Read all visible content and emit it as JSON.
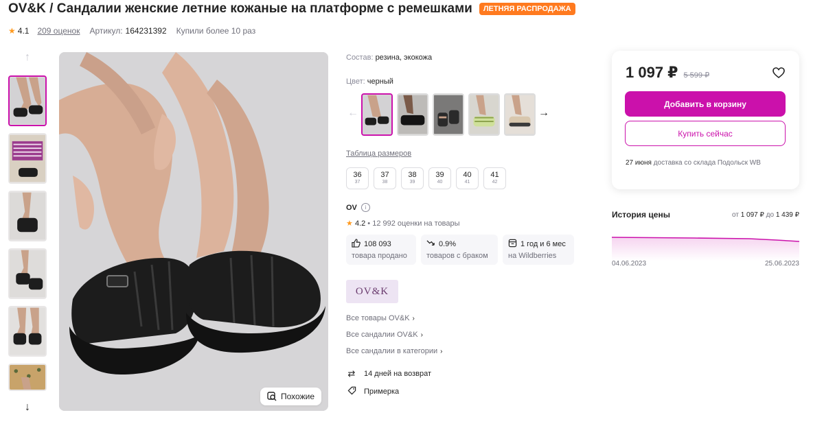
{
  "product": {
    "title": "OV&K / Сандалии женские летние кожаные на платформе с ремешками",
    "badge": "ЛЕТНЯЯ РАСПРОДАЖА",
    "rating": "4.1",
    "reviews": "209 оценок",
    "article_label": "Артикул:",
    "article_value": "164231392",
    "bought": "Купили более 10 раз"
  },
  "gallery": {
    "similar_label": "Похожие"
  },
  "details": {
    "composition_label": "Состав:",
    "composition_value": "резина, экокожа",
    "color_label": "Цвет:",
    "color_value": "черный",
    "size_table_link": "Таблица размеров",
    "sizes": [
      {
        "main": "36",
        "sub": "37"
      },
      {
        "main": "37",
        "sub": "38"
      },
      {
        "main": "38",
        "sub": "39"
      },
      {
        "main": "39",
        "sub": "40"
      },
      {
        "main": "40",
        "sub": "41"
      },
      {
        "main": "41",
        "sub": "42"
      }
    ]
  },
  "seller": {
    "name": "OV",
    "rating": "4.2",
    "rating_text": "• 12 992 оценки на товары",
    "stats": [
      {
        "value": "108 093",
        "label": "товара продано",
        "icon": "thumbs-up-icon"
      },
      {
        "value": "0.9%",
        "label": "товаров с браком",
        "icon": "trend-down-icon"
      },
      {
        "value": "1 год и 6 мес",
        "label": "на Wildberries",
        "icon": "store-icon"
      }
    ],
    "logo_text": "OV&K"
  },
  "links": {
    "all_brand": "Все товары OV&K",
    "all_sandals_brand": "Все сандалии OV&K",
    "all_sandals_category": "Все сандалии в категории"
  },
  "extras": {
    "return_policy": "14 дней на возврат",
    "fitting": "Примерка"
  },
  "price": {
    "current": "1 097 ₽",
    "old": "5 599 ₽",
    "add_to_cart": "Добавить в корзину",
    "buy_now": "Купить сейчас",
    "delivery_date": "27 июня",
    "delivery_text": "доставка со склада Подольск WB"
  },
  "history": {
    "title": "История цены",
    "range_from_label": "от",
    "range_from": "1 097 ₽",
    "range_to_label": "до",
    "range_to": "1 439 ₽",
    "start_date": "04.06.2023",
    "end_date": "25.06.2023"
  },
  "colors": {
    "accent": "#cb11ab",
    "badge": "#ff7a1f",
    "star": "#ff9a1f"
  }
}
